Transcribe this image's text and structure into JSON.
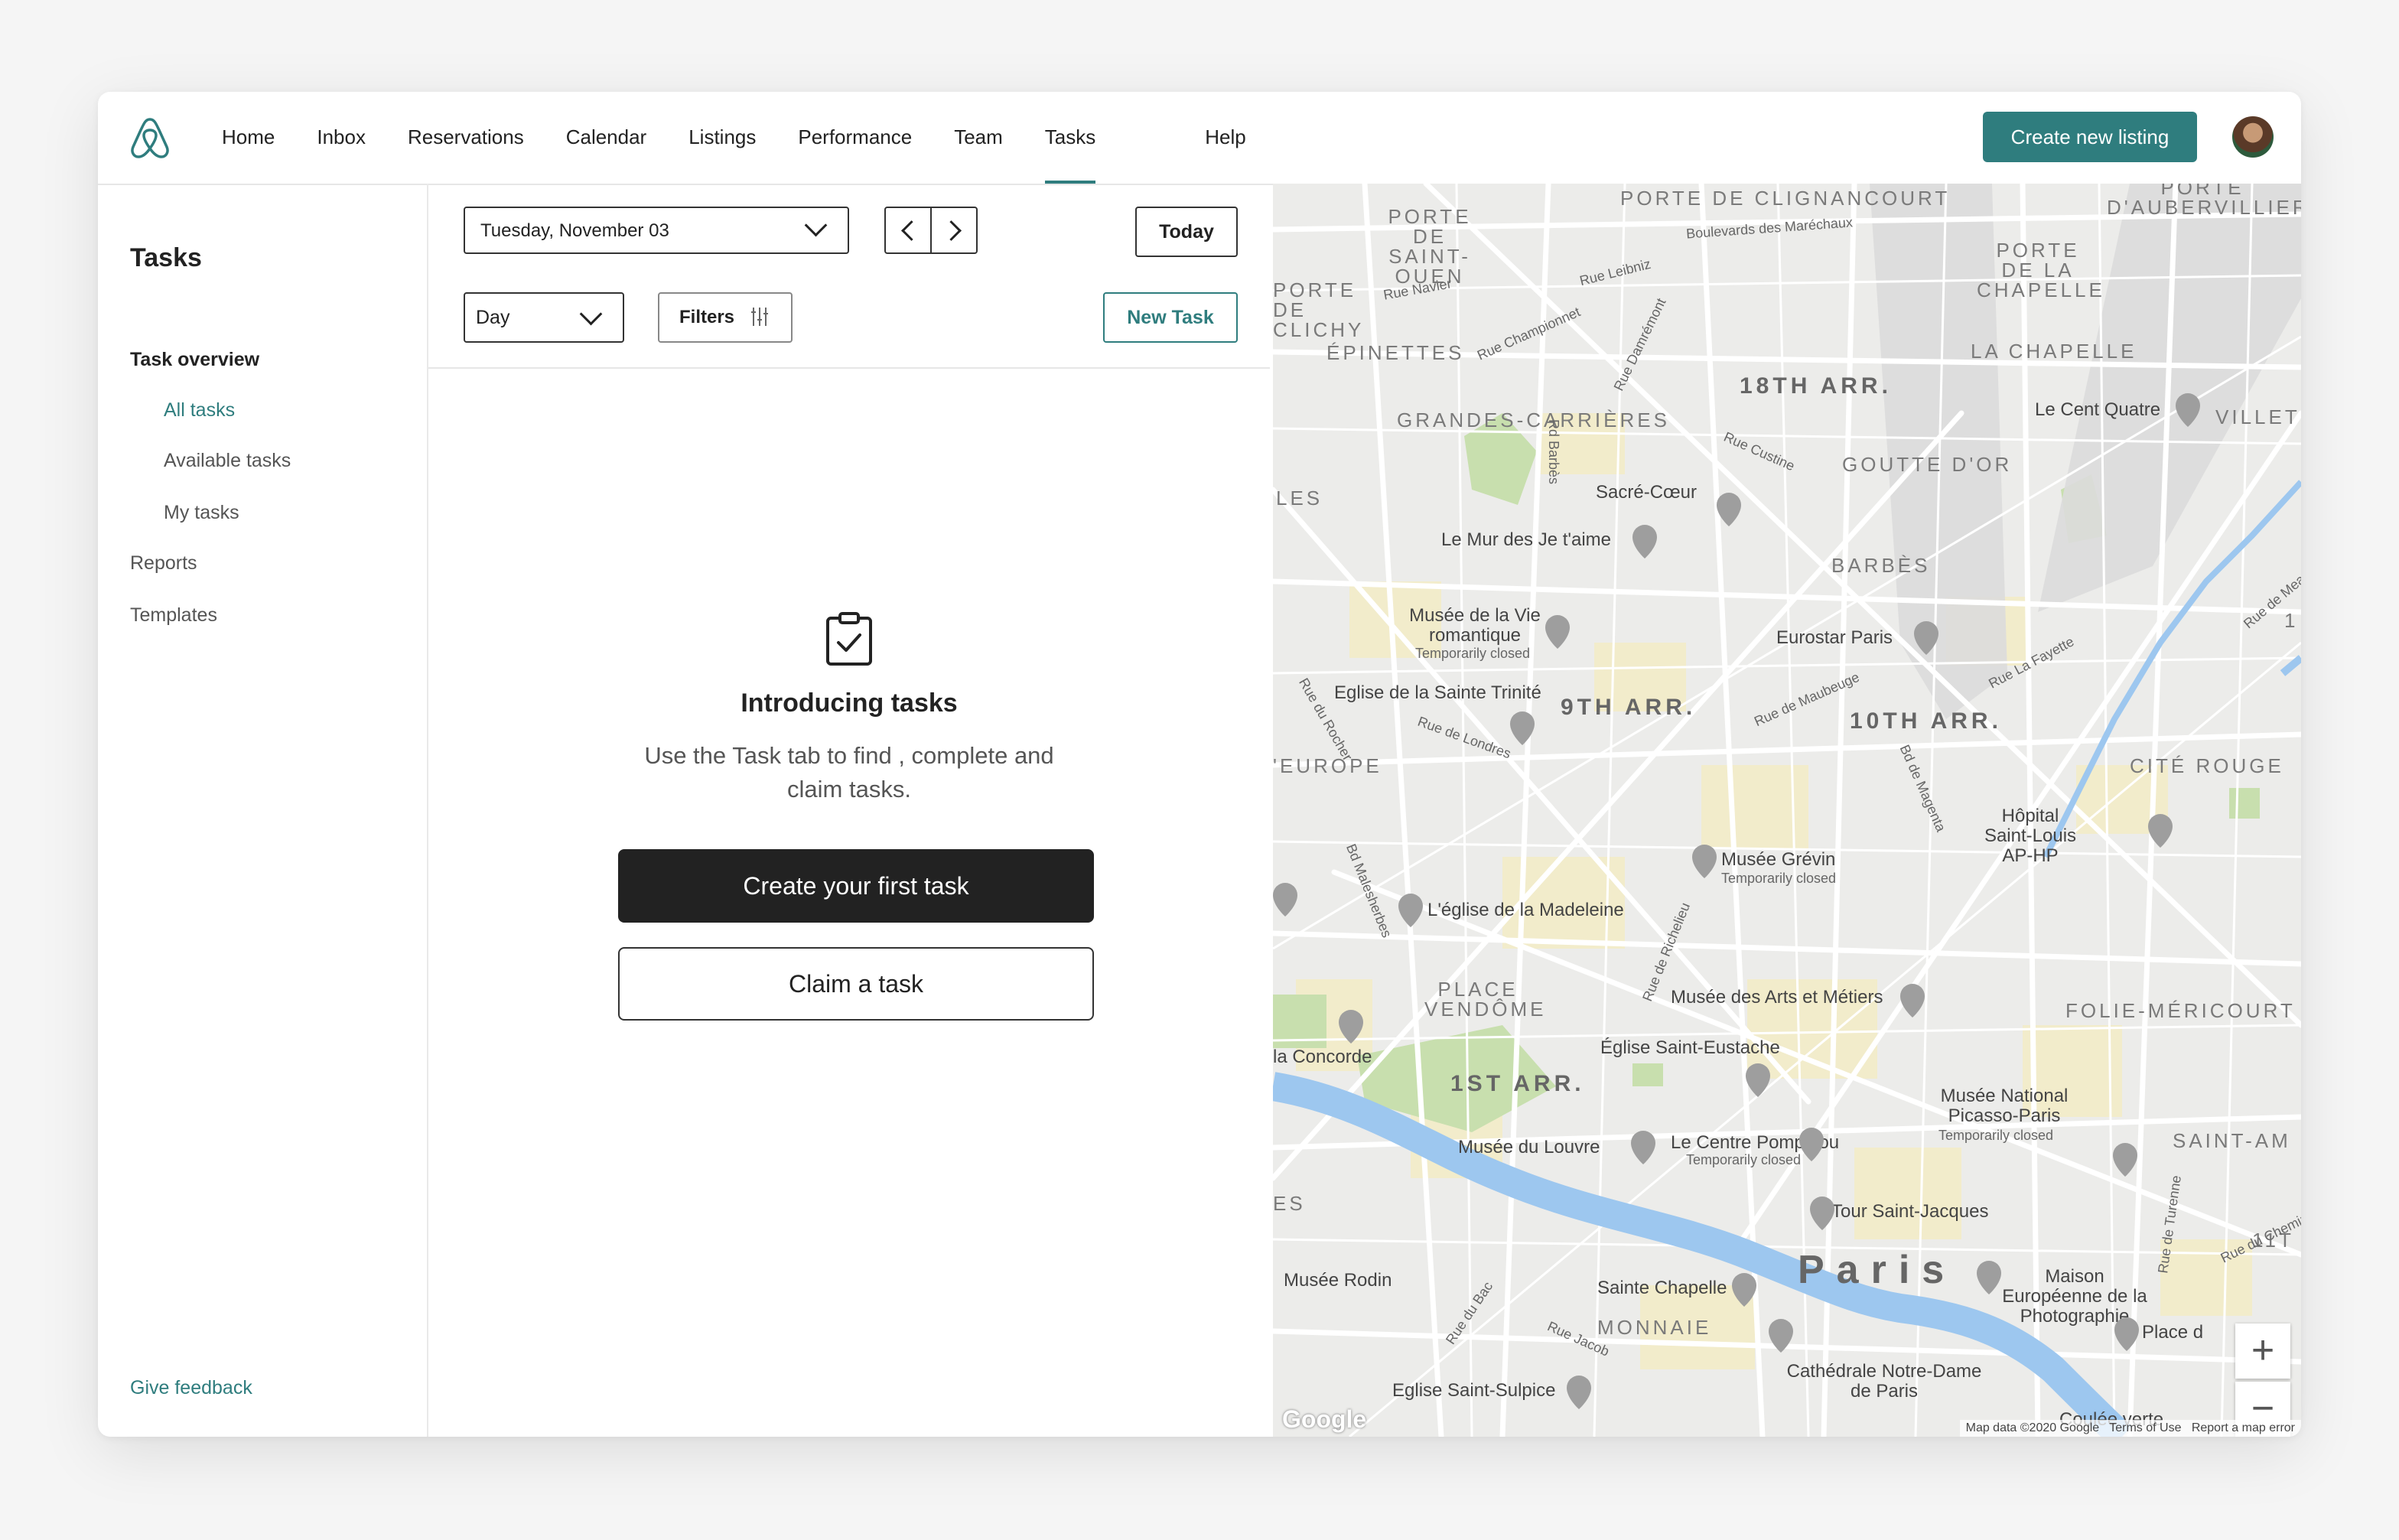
{
  "nav": {
    "items": [
      "Home",
      "Inbox",
      "Reservations",
      "Calendar",
      "Listings",
      "Performance",
      "Team",
      "Tasks"
    ],
    "active": "Tasks",
    "help": "Help",
    "create_listing": "Create new listing"
  },
  "sidebar": {
    "title": "Tasks",
    "section": "Task overview",
    "sub_items": [
      "All tasks",
      "Available tasks",
      "My tasks"
    ],
    "active_item": "All tasks",
    "items": [
      "Reports",
      "Templates"
    ],
    "feedback": "Give feedback"
  },
  "toolbar": {
    "date_value": "Tuesday, November 03",
    "today_label": "Today",
    "view_value": "Day",
    "filters_label": "Filters",
    "new_task_label": "New Task"
  },
  "empty_state": {
    "title": "Introducing tasks",
    "subtitle": "Use the Task tab to find , complete and claim tasks.",
    "primary_button": "Create your first task",
    "secondary_button": "Claim a task"
  },
  "map": {
    "districts": [
      "18TH ARR.",
      "9TH ARR.",
      "10TH ARR.",
      "1ST ARR."
    ],
    "neighborhoods": [
      "PORTE DE CLIGNANCOURT",
      "PORTE DE SAINT-OUEN",
      "PORTE D'AUBERVILLIERS",
      "PORTE DE LA CHAPELLE",
      "LA CHAPELLE",
      "PORTE DE CLICHY",
      "ÉPINETTES",
      "GRANDES-CARRIÈRES",
      "GOUTTE D'OR",
      "BARBÈS",
      "CITÉ ROUGE",
      "PLACE VENDÔME",
      "FOLIE-MÉRICOURT",
      "SAINT-AM",
      "MONNAIE",
      "VILLET",
      "LES",
      "'EUROPE",
      "ES",
      "1",
      "11T"
    ],
    "pois": [
      "Sacré-Cœur",
      "Le Mur des Je t'aime",
      "Le Cent Quatre",
      "Musée de la Vie romantique",
      "Eurostar Paris",
      "Eglise de la Sainte Trinité",
      "Hôpital Saint-Louis AP-HP",
      "Musée Grévin",
      "L'église de la Madeleine",
      "Musée des Arts et Métiers",
      "Église Saint-Eustache",
      "Musée National Picasso-Paris",
      "la Concorde",
      "Musée du Louvre",
      "Le Centre Pompidou",
      "Tour Saint-Jacques",
      "Musée Rodin",
      "Sainte Chapelle",
      "Maison Européenne de la Photographie",
      "Place d",
      "Eglise Saint-Sulpice",
      "Cathédrale Notre-Dame de Paris",
      "Coulée verte"
    ],
    "poi_status": "Temporarily closed",
    "streets": [
      "Boulevards des Maréchaux",
      "Rue Navier",
      "Rue Championnet",
      "Rue Custine",
      "Rue de Maubeuge",
      "Rue La Fayette",
      "Rue de Londres",
      "Rue du Rocher",
      "Rue de Richelieu",
      "Rue Leibniz",
      "Rue Damrémont",
      "Rd Barbès",
      "Rue de Meaux",
      "Rue du Bac",
      "Rue Jacob",
      "Rue de Turenne",
      "Rue du Chemin Vert",
      "Bd Malesherbes",
      "Bd de Magenta"
    ],
    "city": "Paris",
    "zoom_in": "+",
    "zoom_out": "−",
    "attribution": [
      "Map data ©2020 Google",
      "Terms of Use",
      "Report a map error"
    ],
    "brand": "Google"
  },
  "colors": {
    "accent": "#2f7d7e",
    "dark_button": "#222222"
  }
}
